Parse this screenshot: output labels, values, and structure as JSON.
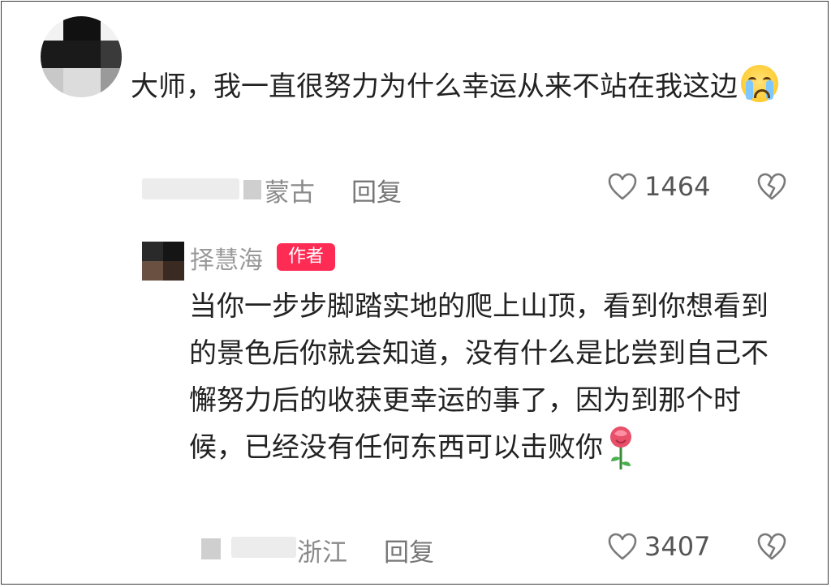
{
  "comment": {
    "text": "大师，我一直很努力为什么幸运从来不站在我这边",
    "emoji": "loudly-crying-face",
    "location": "蒙古",
    "reply_label": "回复",
    "likes": "1464"
  },
  "reply": {
    "author": "择慧海",
    "badge": "作者",
    "text": "当你一步步脚踏实地的爬上山顶，看到你想看到的景色后你就会知道，没有什么是比尝到自己不懈努力后的收获更幸运的事了，因为到那个时候，已经没有任何东西可以击败你",
    "emoji": "rose",
    "location": "浙江",
    "reply_label": "回复",
    "likes": "3407"
  },
  "icons": {
    "like": "heart-outline-icon",
    "dislike": "broken-heart-icon"
  },
  "colors": {
    "badge_bg": "#fe2c55",
    "meta_text": "#8a8a8a",
    "body_text": "#222222"
  }
}
